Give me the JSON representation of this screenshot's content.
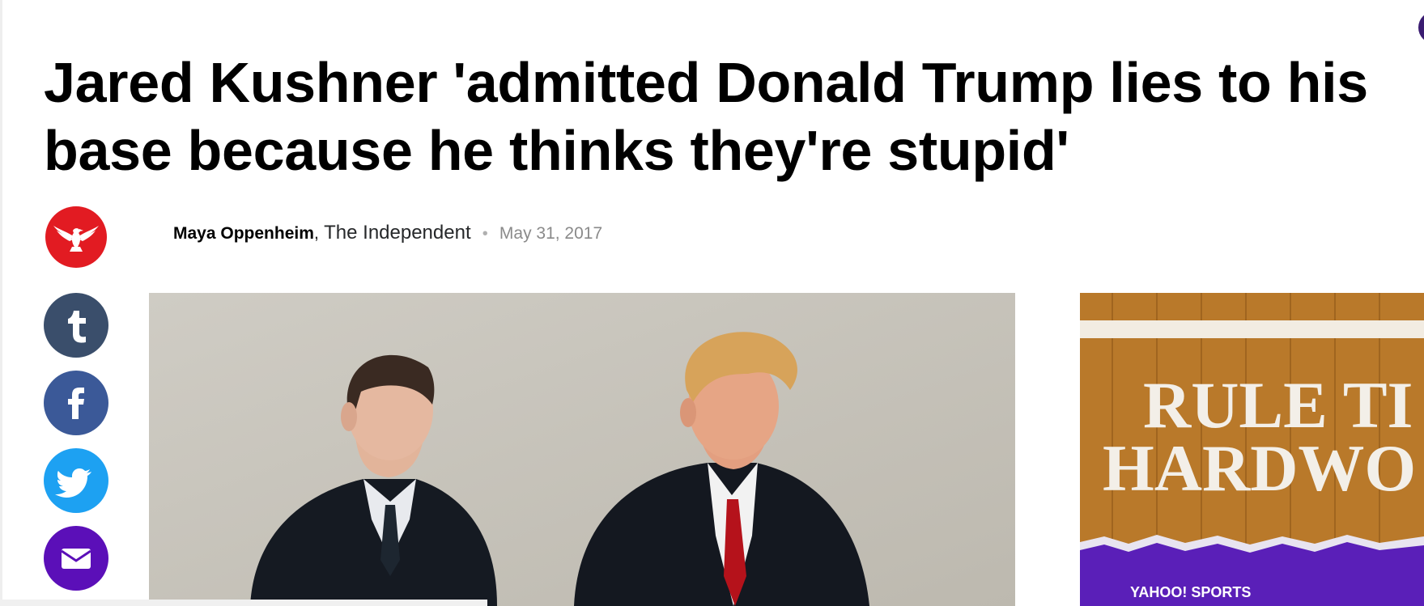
{
  "article": {
    "headline_line1": "Jared Kushner 'admitted Donald Trump lies to his",
    "headline_line2": "base because he thinks they're stupid'",
    "author": "Maya Oppenheim",
    "source": "The Independent",
    "separator": "•",
    "date": "May 31, 2017"
  },
  "publisher": {
    "logo_icon": "eagle-icon",
    "color": "#e21b22"
  },
  "share": [
    {
      "name": "tumblr",
      "icon": "tumblr-icon",
      "color": "#3a4e6b"
    },
    {
      "name": "facebook",
      "icon": "facebook-icon",
      "color": "#3b5998"
    },
    {
      "name": "twitter",
      "icon": "twitter-icon",
      "color": "#1da1f2"
    },
    {
      "name": "mail",
      "icon": "mail-icon",
      "color": "#5b0fb8"
    }
  ],
  "ad": {
    "text_line1": "RULE TI",
    "text_line2": "HARDWO",
    "brand": "YAHOO! SPORTS",
    "colors": {
      "wood": "#b9792a",
      "purple": "#5a1fb8"
    }
  }
}
